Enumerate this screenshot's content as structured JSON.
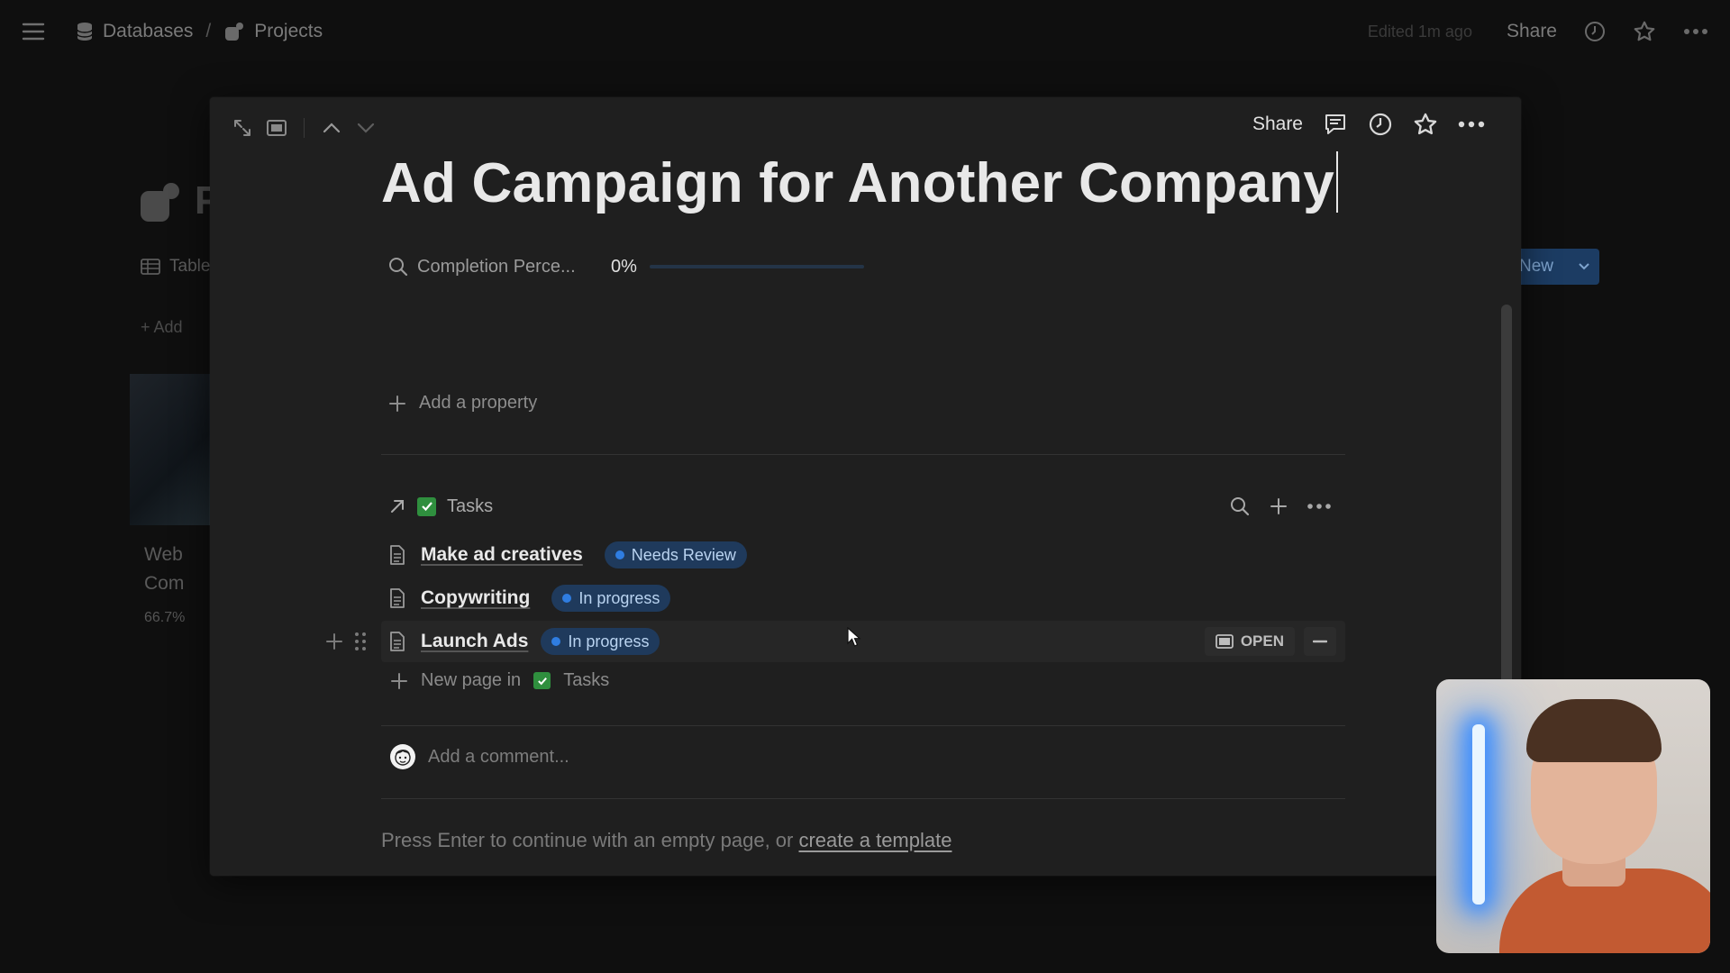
{
  "topbar": {
    "breadcrumb": [
      {
        "label": "Databases",
        "icon": "database-icon"
      },
      {
        "label": "Projects",
        "icon": "projects-icon"
      }
    ],
    "edited": "Edited 1m ago",
    "share_label": "Share"
  },
  "background": {
    "title_fragment": "P",
    "view_tab": "Table",
    "add_view": "+ Add",
    "card_title_line1": "Web",
    "card_title_line2": "Com",
    "card_percent": "66.7%",
    "new_button": "New"
  },
  "modal": {
    "share_label": "Share",
    "title": "Ad Campaign for Another Company",
    "property": {
      "name": "Completion Perce...",
      "value": "0%",
      "progress": 0
    },
    "add_property": "Add a property",
    "tasks": {
      "label": "Tasks",
      "rows": [
        {
          "name": "Make ad creatives",
          "status": "Needs Review"
        },
        {
          "name": "Copywriting",
          "status": "In progress"
        },
        {
          "name": "Launch Ads",
          "status": "In progress"
        }
      ],
      "open_label": "OPEN",
      "new_page_prefix": "New page in",
      "new_page_target": "Tasks"
    },
    "comment_placeholder": "Add a comment...",
    "hint_text": "Press Enter to continue with an empty page, or ",
    "hint_link": "create a template"
  },
  "colors": {
    "status_badge_bg": "#1f3a5c",
    "status_dot": "#2f7de1",
    "checkbox": "#2f8f3e",
    "background": "#0f0f0f",
    "modal": "#1f1f1f"
  }
}
